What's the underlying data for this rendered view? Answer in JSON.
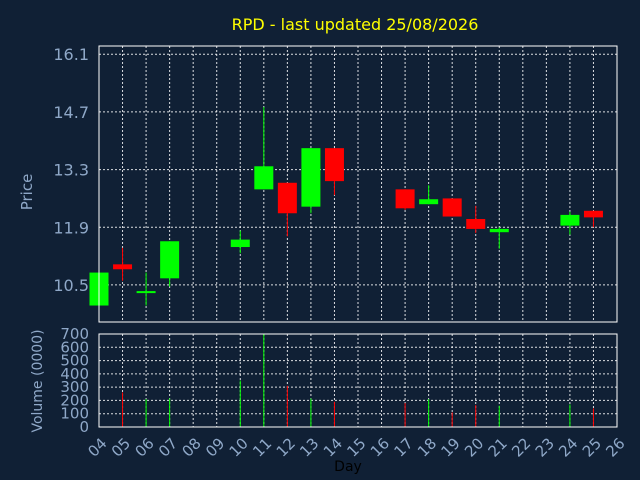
{
  "chart_data": {
    "type": "candlestick",
    "title": "RPD - last updated 25/08/2026",
    "xlabel": "Day",
    "price_ylabel": "Price",
    "volume_ylabel": "Volume (0000)",
    "x_ticks": [
      "04",
      "05",
      "06",
      "07",
      "08",
      "09",
      "10",
      "11",
      "12",
      "13",
      "14",
      "15",
      "16",
      "17",
      "18",
      "19",
      "20",
      "21",
      "22",
      "23",
      "24",
      "25",
      "26"
    ],
    "price_ticks": [
      "10.5",
      "11.9",
      "13.3",
      "14.7",
      "16.1"
    ],
    "price_ylim": [
      9.6,
      16.3
    ],
    "volume_ticks": [
      "0",
      "100",
      "200",
      "300",
      "400",
      "500",
      "600",
      "700"
    ],
    "volume_ylim": [
      0,
      700
    ],
    "grid": true,
    "up_color": "#00ff00",
    "down_color": "#ff0000",
    "background": "#102035",
    "title_color": "#ffff00",
    "candles": [
      {
        "day": "04",
        "open": 10.0,
        "high": 10.8,
        "low": 10.0,
        "close": 10.8,
        "volume": 0
      },
      {
        "day": "05",
        "open": 11.0,
        "high": 11.4,
        "low": 10.6,
        "close": 10.88,
        "volume": 260
      },
      {
        "day": "06",
        "open": 10.35,
        "high": 10.8,
        "low": 10.0,
        "close": 10.35,
        "volume": 210
      },
      {
        "day": "07",
        "open": 10.66,
        "high": 11.56,
        "low": 10.46,
        "close": 11.56,
        "volume": 215
      },
      {
        "day": "10",
        "open": 11.42,
        "high": 11.82,
        "low": 11.27,
        "close": 11.6,
        "volume": 350
      },
      {
        "day": "11",
        "open": 12.82,
        "high": 14.82,
        "low": 12.82,
        "close": 13.38,
        "volume": 700
      },
      {
        "day": "12",
        "open": 12.98,
        "high": 12.98,
        "low": 11.68,
        "close": 12.24,
        "volume": 310
      },
      {
        "day": "13",
        "open": 12.4,
        "high": 13.82,
        "low": 12.24,
        "close": 13.82,
        "volume": 215
      },
      {
        "day": "14",
        "open": 13.82,
        "high": 13.82,
        "low": 12.68,
        "close": 13.02,
        "volume": 190
      },
      {
        "day": "17",
        "open": 12.82,
        "high": 12.82,
        "low": 12.32,
        "close": 12.36,
        "volume": 180
      },
      {
        "day": "18",
        "open": 12.46,
        "high": 12.92,
        "low": 12.46,
        "close": 12.58,
        "volume": 210
      },
      {
        "day": "19",
        "open": 12.6,
        "high": 12.6,
        "low": 12.16,
        "close": 12.16,
        "volume": 110
      },
      {
        "day": "20",
        "open": 12.1,
        "high": 12.42,
        "low": 11.76,
        "close": 11.86,
        "volume": 165
      },
      {
        "day": "21",
        "open": 11.78,
        "high": 11.9,
        "low": 11.38,
        "close": 11.86,
        "volume": 160
      },
      {
        "day": "24",
        "open": 11.94,
        "high": 12.28,
        "low": 11.72,
        "close": 12.2,
        "volume": 170
      },
      {
        "day": "25",
        "open": 12.3,
        "high": 12.3,
        "low": 11.9,
        "close": 12.14,
        "volume": 140
      }
    ]
  }
}
